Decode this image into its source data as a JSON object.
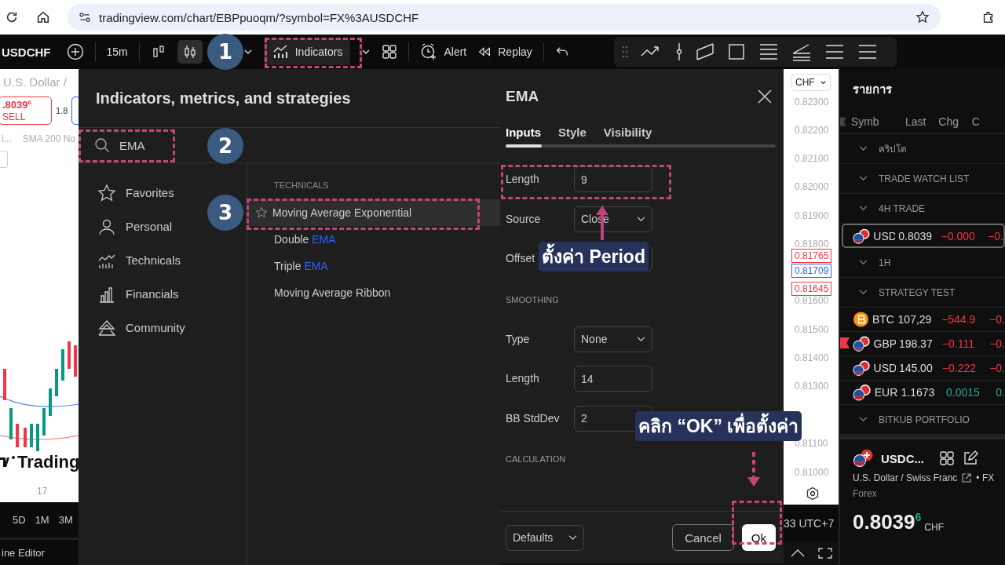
{
  "browser": {
    "url": "tradingview.com/chart/EBPpuoqm/?symbol=FX%3AUSDCHF"
  },
  "toolbar": {
    "symbol": "USDCHF",
    "interval": "15m",
    "indicators": "Indicators",
    "alert": "Alert",
    "replay": "Replay"
  },
  "chart": {
    "title": "U.S. Dollar /",
    "sell_price": ".8039",
    "sell_price_sup": "6",
    "sell_label": "SELL",
    "spread": "1.8",
    "legend": [
      "i...",
      "SMA 200 No"
    ],
    "logo_text": "Trading",
    "date_label": "17",
    "ranges": [
      "5D",
      "1M",
      "3M"
    ],
    "bottom_tab": "ine Editor"
  },
  "price_axis": {
    "currency": "CHF",
    "ticks": [
      "0.82300",
      "0.82200",
      "0.82100",
      "0.82000",
      "0.81900",
      "0.81800",
      "0.81600",
      "0.81500",
      "0.81400",
      "0.81300",
      "0.81100",
      "0.81000"
    ],
    "markers": [
      {
        "value": "0.81765",
        "color": "#f23645"
      },
      {
        "value": "0.81709",
        "color": "#2962ff"
      },
      {
        "value": "0.81645",
        "color": "#f23645"
      }
    ],
    "time": "33 UTC+7"
  },
  "indicators_dialog": {
    "title": "Indicators, metrics, and strategies",
    "search": {
      "value": "EMA"
    },
    "categories": [
      {
        "label": "Favorites"
      },
      {
        "label": "Personal"
      },
      {
        "label": "Technicals"
      },
      {
        "label": "Financials"
      },
      {
        "label": "Community"
      }
    ],
    "section": "TECHNICALS",
    "results": [
      {
        "text": "Moving Average Exponential",
        "selected": true
      },
      {
        "text": "Double",
        "match": "EMA",
        "selected": false
      },
      {
        "text": "Triple",
        "match": "EMA",
        "selected": false
      },
      {
        "text": "Moving Average Ribbon",
        "selected": false
      }
    ]
  },
  "settings_dialog": {
    "title": "EMA",
    "tabs": [
      {
        "label": "Inputs",
        "selected": true
      },
      {
        "label": "Style",
        "selected": false
      },
      {
        "label": "Visibility",
        "selected": false
      }
    ],
    "inputs": [
      {
        "kind": "field",
        "label": "Length",
        "value": "9"
      },
      {
        "kind": "select",
        "label": "Source",
        "value": "Close"
      },
      {
        "kind": "field",
        "label": "Offset"
      },
      {
        "kind": "heading",
        "label": "SMOOTHING"
      },
      {
        "kind": "select",
        "label": "Type",
        "value": "None"
      },
      {
        "kind": "field",
        "label": "Length",
        "value": "14"
      },
      {
        "kind": "field",
        "label": "BB StdDev",
        "value": "2"
      },
      {
        "kind": "heading",
        "label": "CALCULATION"
      }
    ],
    "defaults": "Defaults",
    "cancel": "Cancel",
    "ok": "Ok"
  },
  "watchlist": {
    "title": "รายการ",
    "columns": [
      "Symb",
      "Last",
      "Chg",
      "C"
    ],
    "rows": [
      {
        "kind": "group",
        "label": "คริปโต"
      },
      {
        "kind": "group",
        "label": "TRADE WATCH LIST"
      },
      {
        "kind": "group",
        "label": "4H TRADE"
      },
      {
        "kind": "forex",
        "symbol": "USD",
        "last": "0.8039",
        "change": "−0.000",
        "change_pct": "−0.",
        "color": "#f23645",
        "selected": true,
        "flagged": false
      },
      {
        "kind": "group",
        "label": "1H"
      },
      {
        "kind": "group",
        "label": "STRATEGY TEST"
      },
      {
        "kind": "crypto",
        "symbol": "BTC",
        "last": "107,29",
        "change": "−544.9",
        "change_pct": "−0.",
        "color": "#f23645",
        "selected": false,
        "flagged": false
      },
      {
        "kind": "forex",
        "symbol": "GBP",
        "last": "198.37",
        "change": "−0.111",
        "change_pct": "−0.",
        "color": "#f23645",
        "selected": false,
        "flagged": true
      },
      {
        "kind": "forex",
        "symbol": "USD",
        "last": "145.00",
        "change": "−0.222",
        "change_pct": "−0.",
        "color": "#f23645",
        "selected": false,
        "flagged": false
      },
      {
        "kind": "forex",
        "symbol": "EUR",
        "last": "1.1673",
        "change": "0.0015",
        "change_pct": "0.",
        "color": "#22ab94",
        "selected": false,
        "flagged": false
      },
      {
        "kind": "group",
        "label": "BITKUB PORTFOLIO"
      }
    ]
  },
  "details": {
    "symbol": "USDC...",
    "name": "U.S. Dollar / Swiss Franc",
    "exchange": "• FX",
    "type": "Forex",
    "price": "0.8039",
    "price_sup": "6",
    "currency": "CHF"
  },
  "annotations": {
    "steps": [
      "1",
      "2",
      "3"
    ],
    "callouts": [
      "ตั้งค่า Period",
      "คลิก “OK” เพื่อตั้งค่า"
    ]
  }
}
